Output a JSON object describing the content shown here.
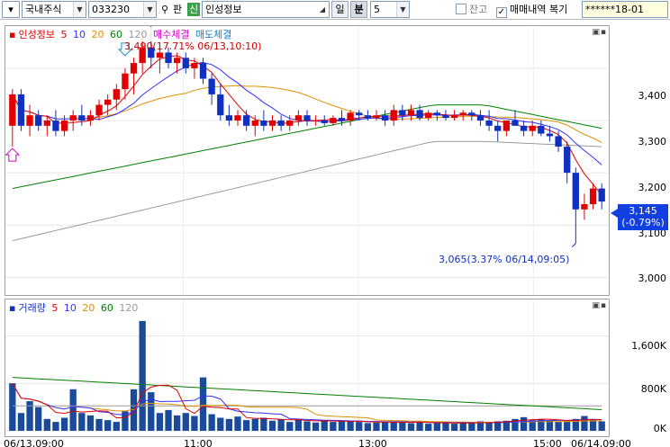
{
  "toolbar": {
    "market": "국내주식",
    "code": "033230",
    "search_icon": "search-icon",
    "pan_label": "판",
    "new_badge": "신",
    "stock_name": "인성정보",
    "period_day": "일",
    "period_min": "분",
    "interval": "5",
    "balance_label": "잔고",
    "trade_history_label": "매매내역 복기",
    "trade_history_checked": true,
    "account": "******18-01"
  },
  "price_panel": {
    "legend": {
      "name": "인성정보",
      "ma": [
        {
          "label": "5",
          "color": "#e00000"
        },
        {
          "label": "10",
          "color": "#3030ff"
        },
        {
          "label": "20",
          "color": "#e09000"
        },
        {
          "label": "60",
          "color": "#008000"
        },
        {
          "label": "120",
          "color": "#999999"
        }
      ],
      "buy": "매수체결",
      "sell": "매도체결"
    },
    "high_annotation": "3,490(17.71% 06/13,10:10)",
    "low_annotation": "3,065(3.37% 06/14,09:05)",
    "y_ticks": [
      "3,400",
      "3,300",
      "3,200",
      "3,100",
      "3,000"
    ],
    "current_price": "3,145",
    "current_change": "(-0.79%)"
  },
  "volume_panel": {
    "legend": {
      "name": "거래량",
      "ma": [
        {
          "label": "5",
          "color": "#e00000"
        },
        {
          "label": "10",
          "color": "#3030ff"
        },
        {
          "label": "20",
          "color": "#e09000"
        },
        {
          "label": "60",
          "color": "#008000"
        },
        {
          "label": "120",
          "color": "#999999"
        }
      ]
    },
    "y_ticks": [
      "1,600K",
      "800K",
      "0K"
    ]
  },
  "x_ticks": [
    "06/13,09:00",
    "11:00",
    "13:00",
    "15:00",
    "06/14,09:00"
  ],
  "colors": {
    "up": "#e00000",
    "down": "#1030c0",
    "volume_bar": "#1a4a9a",
    "ma5": "#e00000",
    "ma10": "#3030ff",
    "ma20": "#e09000",
    "ma60": "#008000",
    "ma120": "#999999",
    "tag": "#1240e0"
  },
  "chart_data": [
    {
      "type": "line",
      "title": "인성정보",
      "ylim": [
        2980,
        3460
      ],
      "ohlc": [
        [
          3290,
          3360,
          3250,
          3350
        ],
        [
          3350,
          3360,
          3280,
          3290
        ],
        [
          3290,
          3330,
          3270,
          3310
        ],
        [
          3310,
          3320,
          3280,
          3290
        ],
        [
          3290,
          3310,
          3270,
          3300
        ],
        [
          3300,
          3320,
          3270,
          3280
        ],
        [
          3280,
          3310,
          3270,
          3300
        ],
        [
          3300,
          3320,
          3280,
          3310
        ],
        [
          3310,
          3330,
          3290,
          3300
        ],
        [
          3300,
          3320,
          3290,
          3310
        ],
        [
          3310,
          3340,
          3300,
          3330
        ],
        [
          3330,
          3350,
          3310,
          3340
        ],
        [
          3340,
          3370,
          3320,
          3360
        ],
        [
          3360,
          3400,
          3340,
          3390
        ],
        [
          3390,
          3420,
          3350,
          3410
        ],
        [
          3410,
          3460,
          3390,
          3440
        ],
        [
          3440,
          3490,
          3400,
          3420
        ],
        [
          3420,
          3440,
          3390,
          3430
        ],
        [
          3430,
          3440,
          3400,
          3410
        ],
        [
          3410,
          3430,
          3390,
          3420
        ],
        [
          3420,
          3430,
          3390,
          3400
        ],
        [
          3400,
          3420,
          3380,
          3410
        ],
        [
          3410,
          3420,
          3370,
          3380
        ],
        [
          3380,
          3390,
          3330,
          3350
        ],
        [
          3350,
          3370,
          3300,
          3310
        ],
        [
          3310,
          3330,
          3290,
          3300
        ],
        [
          3300,
          3320,
          3290,
          3310
        ],
        [
          3310,
          3320,
          3280,
          3290
        ],
        [
          3290,
          3310,
          3270,
          3300
        ],
        [
          3300,
          3320,
          3280,
          3290
        ],
        [
          3290,
          3310,
          3280,
          3300
        ],
        [
          3300,
          3310,
          3280,
          3290
        ],
        [
          3290,
          3310,
          3280,
          3300
        ],
        [
          3300,
          3320,
          3290,
          3310
        ],
        [
          3310,
          3320,
          3290,
          3300
        ],
        [
          3300,
          3310,
          3290,
          3300
        ],
        [
          3300,
          3310,
          3290,
          3295
        ],
        [
          3295,
          3310,
          3290,
          3305
        ],
        [
          3305,
          3320,
          3290,
          3300
        ],
        [
          3300,
          3320,
          3290,
          3315
        ],
        [
          3315,
          3320,
          3300,
          3310
        ],
        [
          3310,
          3320,
          3300,
          3305
        ],
        [
          3305,
          3320,
          3300,
          3310
        ],
        [
          3310,
          3320,
          3290,
          3300
        ],
        [
          3300,
          3330,
          3290,
          3320
        ],
        [
          3320,
          3330,
          3300,
          3310
        ],
        [
          3310,
          3330,
          3300,
          3320
        ],
        [
          3320,
          3330,
          3300,
          3305
        ],
        [
          3305,
          3320,
          3300,
          3315
        ],
        [
          3315,
          3320,
          3300,
          3310
        ],
        [
          3310,
          3320,
          3300,
          3305
        ],
        [
          3305,
          3320,
          3300,
          3310
        ],
        [
          3310,
          3320,
          3300,
          3315
        ],
        [
          3315,
          3320,
          3300,
          3310
        ],
        [
          3310,
          3320,
          3290,
          3300
        ],
        [
          3300,
          3320,
          3280,
          3290
        ],
        [
          3290,
          3300,
          3260,
          3280
        ],
        [
          3280,
          3300,
          3270,
          3300
        ],
        [
          3300,
          3320,
          3290,
          3290
        ],
        [
          3290,
          3300,
          3270,
          3280
        ],
        [
          3280,
          3300,
          3270,
          3290
        ],
        [
          3290,
          3300,
          3270,
          3275
        ],
        [
          3275,
          3290,
          3260,
          3270
        ],
        [
          3270,
          3280,
          3240,
          3250
        ],
        [
          3250,
          3260,
          3180,
          3200
        ],
        [
          3200,
          3210,
          3065,
          3130
        ],
        [
          3130,
          3160,
          3110,
          3140
        ],
        [
          3140,
          3180,
          3130,
          3170
        ],
        [
          3170,
          3180,
          3130,
          3145
        ]
      ]
    },
    {
      "type": "bar",
      "title": "거래량",
      "ylim": [
        0,
        2000
      ],
      "values": [
        800,
        300,
        500,
        400,
        200,
        150,
        220,
        700,
        300,
        260,
        200,
        180,
        150,
        330,
        700,
        1850,
        650,
        300,
        350,
        260,
        300,
        250,
        900,
        280,
        220,
        200,
        240,
        180,
        200,
        220,
        170,
        190,
        150,
        200,
        160,
        140,
        180,
        150,
        170,
        160,
        150,
        130,
        140,
        150,
        160,
        140,
        130,
        150,
        120,
        140,
        130,
        120,
        140,
        130,
        160,
        140,
        160,
        170,
        200,
        230,
        180,
        200,
        170,
        150,
        160,
        200,
        250,
        180,
        160
      ]
    }
  ]
}
